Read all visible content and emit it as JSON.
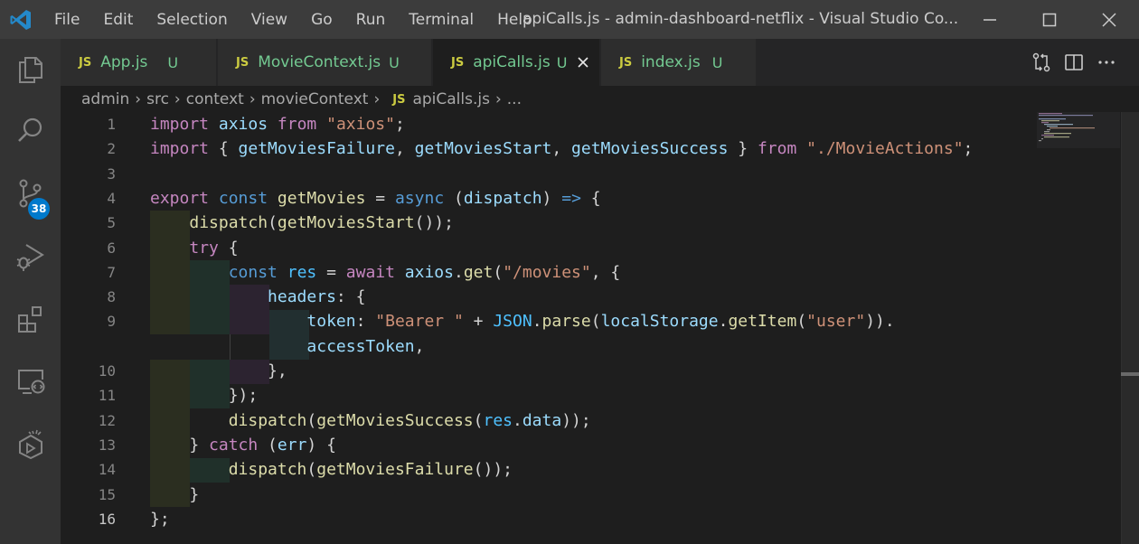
{
  "window": {
    "title": "apiCalls.js - admin-dashboard-netflix - Visual Studio Co...",
    "menu": [
      "File",
      "Edit",
      "Selection",
      "View",
      "Go",
      "Run",
      "Terminal",
      "Help"
    ]
  },
  "activity_bar": {
    "items": [
      "explorer-icon",
      "search-icon",
      "source-control-icon",
      "run-debug-icon",
      "extensions-icon",
      "remote-explorer-icon",
      "testing-icon"
    ],
    "source_control_badge": "38",
    "accent": "#007acc"
  },
  "tabs": [
    {
      "icon": "JS",
      "name": "App.js",
      "status": "U",
      "active": false
    },
    {
      "icon": "JS",
      "name": "MovieContext.js",
      "status": "U",
      "active": false
    },
    {
      "icon": "JS",
      "name": "apiCalls.js",
      "status": "U",
      "active": true
    },
    {
      "icon": "JS",
      "name": "index.js",
      "status": "U",
      "active": false
    }
  ],
  "breadcrumb": {
    "parts": [
      "admin",
      "src",
      "context",
      "movieContext"
    ],
    "file_icon": "JS",
    "file": "apiCalls.js",
    "tail": "..."
  },
  "editor": {
    "current_line": "16",
    "line_numbers": [
      "1",
      "2",
      "3",
      "4",
      "5",
      "6",
      "7",
      "8",
      "9",
      "",
      "10",
      "11",
      "12",
      "13",
      "14",
      "15",
      "16"
    ]
  }
}
